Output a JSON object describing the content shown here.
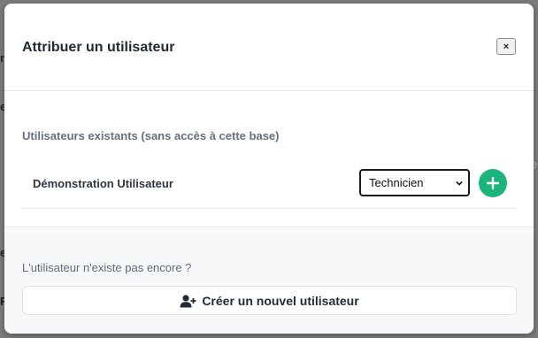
{
  "modal": {
    "title": "Attribuer un utilisateur",
    "close_label": "×"
  },
  "existing_users": {
    "section_label": "Utilisateurs existants (sans accès à cette base)",
    "rows": [
      {
        "name": "Démonstration Utilisateur",
        "role_selected": "Technicien",
        "add_icon": "plus-icon"
      }
    ]
  },
  "footer": {
    "hint": "L'utilisateur n'existe pas encore ?",
    "create_label": "Créer un nouvel utilisateur",
    "create_icon": "user-plus-icon"
  },
  "colors": {
    "accent": "#1bb47b",
    "overlay": "#7d7d7d"
  }
}
